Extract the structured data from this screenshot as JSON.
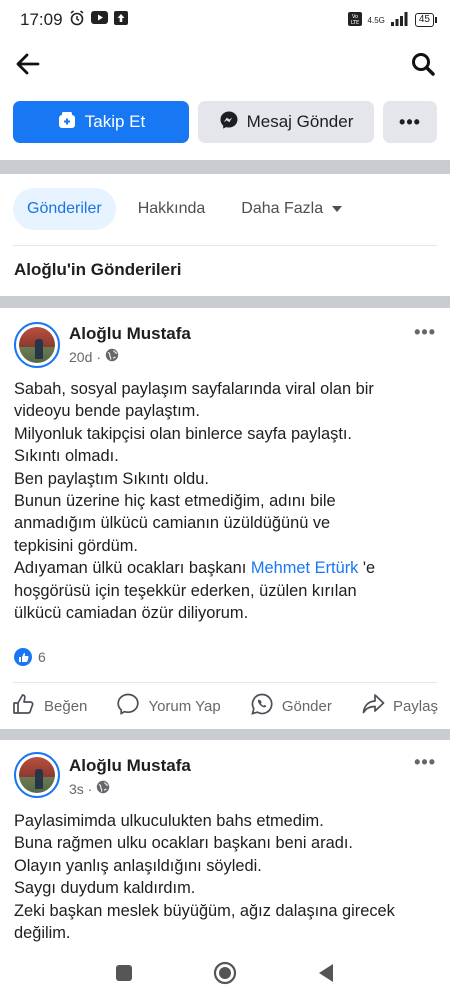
{
  "status_bar": {
    "time": "17:09",
    "network": "4.5G",
    "battery": "45",
    "icons": [
      "alarm-icon",
      "youtube-icon",
      "upload-icon",
      "volte-icon",
      "signal-icon",
      "battery-icon"
    ]
  },
  "topbar": {
    "icons": [
      "back-arrow-icon",
      "search-icon"
    ]
  },
  "actions": {
    "follow_label": "Takip Et",
    "message_label": "Mesaj Gönder",
    "more_label": "•••"
  },
  "tabs": [
    {
      "label": "Gönderiler",
      "active": true
    },
    {
      "label": "Hakkında",
      "active": false
    },
    {
      "label": "Daha Fazla",
      "active": false
    }
  ],
  "section_title": "Aloğlu'in Gönderileri",
  "posts": [
    {
      "author": "Aloğlu Mustafa",
      "time": "20d",
      "privacy_icon": "globe-icon",
      "text_lines": [
        "Sabah, sosyal paylaşım sayfalarında viral olan bir",
        "videoyu bende paylaştım.",
        "Milyonluk takipçisi olan binlerce sayfa paylaştı.",
        "Sıkıntı olmadı.",
        "Ben paylaştım Sıkıntı oldu.",
        "Bunun üzerine hiç kast etmediğim, adını bile",
        "anmadığım ülkücü camianın üzüldüğünü ve",
        "tepkisini gördüm.",
        "Adıyaman ülkü ocakları başkanı ",
        "hoşgörüsü için teşekkür ederken, üzülen kırılan",
        "ülkücü camiadan özür diliyorum."
      ],
      "mention": "Mehmet Ertürk",
      "mention_suffix": " 'e",
      "reaction_count": "6",
      "actions": [
        "Beğen",
        "Yorum Yap",
        "Gönder",
        "Paylaş"
      ]
    },
    {
      "author": "Aloğlu Mustafa",
      "time": "3s",
      "privacy_icon": "globe-icon",
      "text_lines": [
        "Paylasimimda ulkuculukten bahs etmedim.",
        "Buna rağmen ulku ocakları başkanı beni aradı.",
        "Olayın yanlış anlaşıldığını söyledi.",
        "Saygı duydum kaldırdım.",
        "Zeki başkan meslek büyüğüm, ağız dalaşına girecek",
        "değilim."
      ]
    }
  ],
  "navbar": {
    "icons": [
      "recents-icon",
      "home-icon",
      "back-icon"
    ]
  }
}
